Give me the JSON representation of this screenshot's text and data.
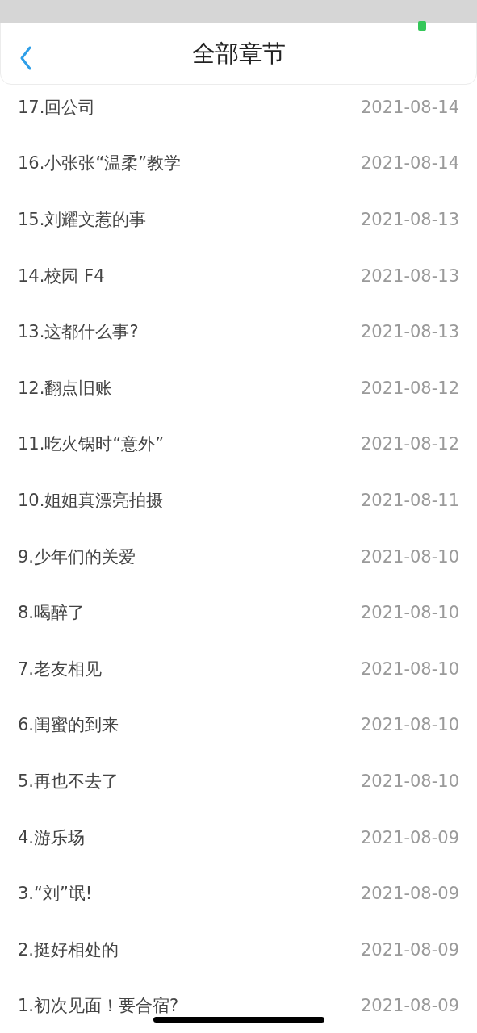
{
  "header": {
    "title": "全部章节"
  },
  "chapters": [
    {
      "title": "17.回公司",
      "date": "2021-08-14"
    },
    {
      "title": "16.小张张“温柔”教学",
      "date": "2021-08-14"
    },
    {
      "title": "15.刘耀文惹的事",
      "date": "2021-08-13"
    },
    {
      "title": "14.校园 F4",
      "date": "2021-08-13"
    },
    {
      "title": "13.这都什么事?",
      "date": "2021-08-13"
    },
    {
      "title": "12.翻点旧账",
      "date": "2021-08-12"
    },
    {
      "title": "11.吃火锅时“意外”",
      "date": "2021-08-12"
    },
    {
      "title": "10.姐姐真漂亮拍摄",
      "date": "2021-08-11"
    },
    {
      "title": "9.少年们的关爱",
      "date": "2021-08-10"
    },
    {
      "title": "8.喝醉了",
      "date": "2021-08-10"
    },
    {
      "title": "7.老友相见",
      "date": "2021-08-10"
    },
    {
      "title": "6.闺蜜的到来",
      "date": "2021-08-10"
    },
    {
      "title": "5.再也不去了",
      "date": "2021-08-10"
    },
    {
      "title": "4.游乐场",
      "date": "2021-08-09"
    },
    {
      "title": "3.“刘”氓!",
      "date": "2021-08-09"
    },
    {
      "title": "2.挺好相处的",
      "date": "2021-08-09"
    },
    {
      "title": "1.初次见面！要合宿?",
      "date": "2021-08-09"
    }
  ]
}
